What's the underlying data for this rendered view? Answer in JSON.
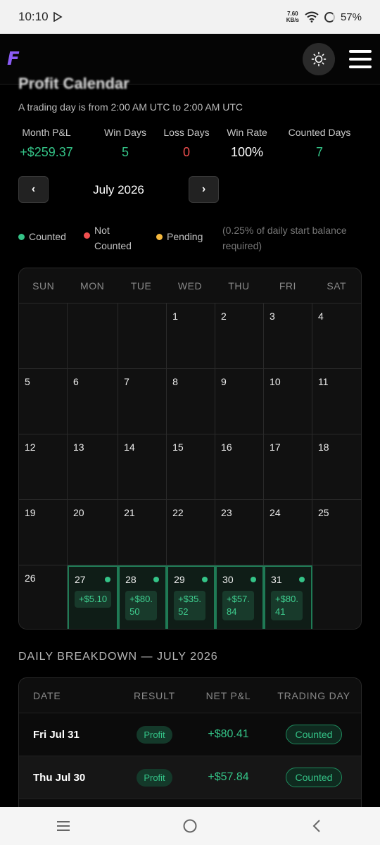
{
  "status_bar": {
    "time": "10:10",
    "net_speed_value": "7.60",
    "net_speed_unit": "KB/s",
    "battery": "57%"
  },
  "header": {
    "logo": "F"
  },
  "page": {
    "title": "Profit Calendar",
    "subtitle": "A trading day is from 2:00 AM UTC to 2:00 AM UTC"
  },
  "stats": [
    {
      "label": "Month P&L",
      "value": "+$259.37",
      "color": "green"
    },
    {
      "label": "Win Days",
      "value": "5",
      "color": "green"
    },
    {
      "label": "Loss Days",
      "value": "0",
      "color": "red"
    },
    {
      "label": "Win Rate",
      "value": "100%",
      "color": "white"
    },
    {
      "label": "Counted Days",
      "value": "7",
      "color": "green"
    }
  ],
  "month_nav": {
    "prev": "‹",
    "month": "July 2026",
    "next": "›"
  },
  "legend": {
    "counted": "Counted",
    "not_counted_1": "Not",
    "not_counted_2": "Counted",
    "pending": "Pending",
    "note_1": "(0.25% of daily start balance",
    "note_2": "required)",
    "colors": {
      "counted": "#34c387",
      "not_counted": "#ef4f4f",
      "pending": "#f5b83d"
    }
  },
  "calendar": {
    "weekdays": [
      "SUN",
      "MON",
      "TUE",
      "WED",
      "THU",
      "FRI",
      "SAT"
    ],
    "days": [
      {
        "d": ""
      },
      {
        "d": ""
      },
      {
        "d": ""
      },
      {
        "d": "1"
      },
      {
        "d": "2"
      },
      {
        "d": "3"
      },
      {
        "d": "4"
      },
      {
        "d": "5"
      },
      {
        "d": "6"
      },
      {
        "d": "7"
      },
      {
        "d": "8"
      },
      {
        "d": "9"
      },
      {
        "d": "10"
      },
      {
        "d": "11"
      },
      {
        "d": "12"
      },
      {
        "d": "13"
      },
      {
        "d": "14"
      },
      {
        "d": "15"
      },
      {
        "d": "16"
      },
      {
        "d": "17"
      },
      {
        "d": "18"
      },
      {
        "d": "19"
      },
      {
        "d": "20"
      },
      {
        "d": "21"
      },
      {
        "d": "22"
      },
      {
        "d": "23"
      },
      {
        "d": "24"
      },
      {
        "d": "25"
      },
      {
        "d": "26"
      },
      {
        "d": "27",
        "pnl": [
          "+$5.10"
        ],
        "counted": true
      },
      {
        "d": "28",
        "pnl": [
          "+$80.",
          "50"
        ],
        "counted": true
      },
      {
        "d": "29",
        "pnl": [
          "+$35.",
          "52"
        ],
        "counted": true
      },
      {
        "d": "30",
        "pnl": [
          "+$57.",
          "84"
        ],
        "counted": true
      },
      {
        "d": "31",
        "pnl": [
          "+$80.",
          "41"
        ],
        "counted": true
      },
      {
        "d": ""
      }
    ]
  },
  "breakdown": {
    "title": "DAILY BREAKDOWN — JULY 2026",
    "columns": [
      "DATE",
      "RESULT",
      "NET P&L",
      "TRADING DAY"
    ],
    "rows": [
      {
        "date": "Fri Jul 31",
        "result": "Profit",
        "net": "+$80.41",
        "day": "Counted"
      },
      {
        "date": "Thu Jul 30",
        "result": "Profit",
        "net": "+$57.84",
        "day": "Counted"
      }
    ]
  }
}
